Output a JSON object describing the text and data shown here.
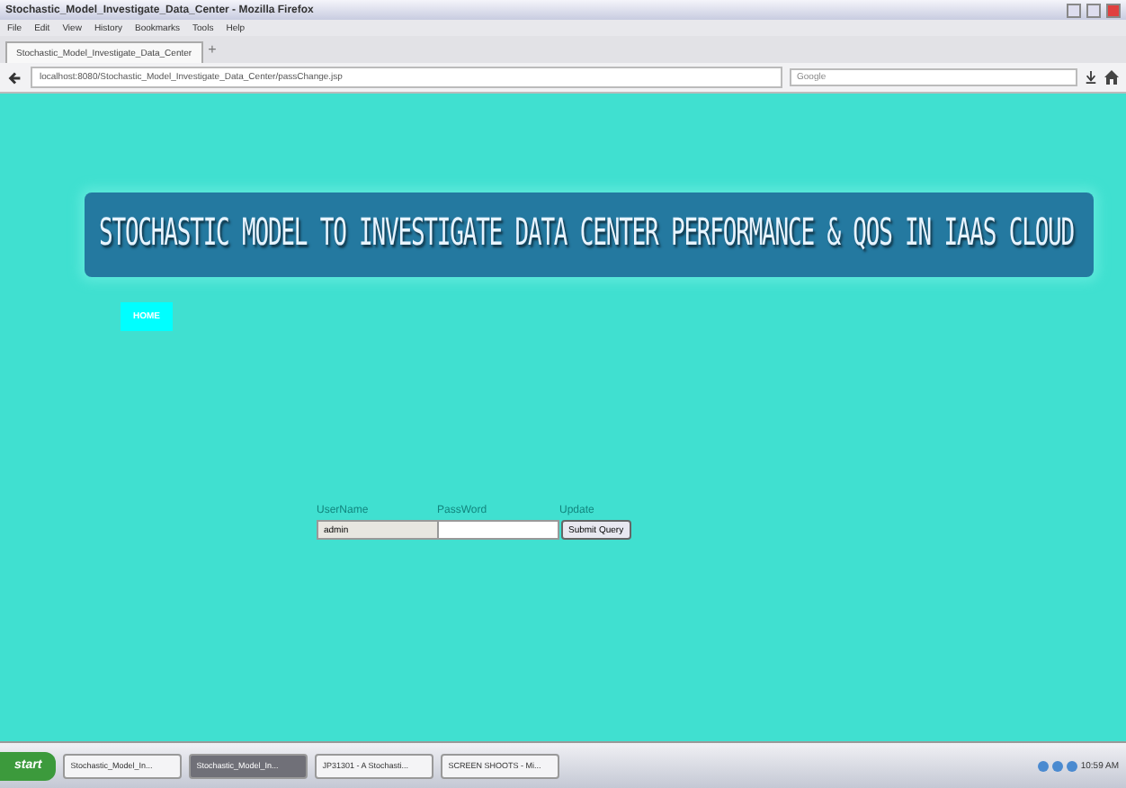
{
  "window": {
    "title": "Stochastic_Model_Investigate_Data_Center - Mozilla Firefox"
  },
  "menu": [
    "File",
    "Edit",
    "View",
    "History",
    "Bookmarks",
    "Tools",
    "Help"
  ],
  "tabs": [
    {
      "label": "Stochastic_Model_Investigate_Data_Center",
      "selected": true
    }
  ],
  "new_tab": "+",
  "address_bar": {
    "url": "localhost:8080/Stochastic_Model_Investigate_Data_Center/passChange.jsp"
  },
  "search": {
    "placeholder": "Google"
  },
  "page": {
    "banner": "STOCHASTIC MODEL TO INVESTIGATE DATA CENTER PERFORMANCE & QOS IN IAAS CLOUD",
    "nav": [
      "HOME"
    ],
    "form": {
      "labels": [
        "UserName",
        "PassWord",
        "Update"
      ],
      "username": "admin",
      "submit": "Submit Query"
    }
  },
  "taskbar": {
    "start": "start",
    "tasks": [
      {
        "label": "Stochastic_Model_In...",
        "selected": false
      },
      {
        "label": "Stochastic_Model_In...",
        "selected": true
      },
      {
        "label": "JP31301 - A Stochasti...",
        "selected": false
      },
      {
        "label": "SCREEN SHOOTS - Mi...",
        "selected": false
      }
    ],
    "clock": "10:59 AM"
  }
}
